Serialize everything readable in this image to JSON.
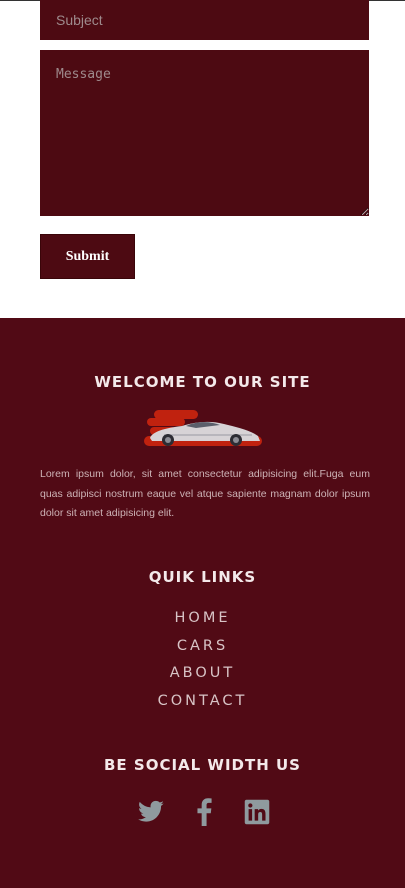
{
  "form": {
    "subject_placeholder": "Subject",
    "message_placeholder": "Message",
    "submit_label": "Submit"
  },
  "footer": {
    "welcome_title": "WELCOME TO OUR SITE",
    "about_text": "Lorem ipsum dolor, sit amet consectetur adipisicing elit.Fuga eum quas adipisci nostrum eaque vel atque sapiente magnam dolor ipsum dolor sit amet adipisicing elit.",
    "links_title": "QUIK LINKS",
    "links": [
      {
        "label": "HOME"
      },
      {
        "label": "CARS"
      },
      {
        "label": "ABOUT"
      },
      {
        "label": "CONTACT"
      }
    ],
    "social_title": "BE SOCIAL WIDTH US",
    "social": [
      {
        "icon": "twitter-icon"
      },
      {
        "icon": "facebook-icon"
      },
      {
        "icon": "linkedin-icon"
      }
    ]
  },
  "colors": {
    "footer_bg": "#510a15",
    "field_bg": "#4d0a12",
    "logo_accent": "#c0220f",
    "social_icon": "#8f9a9e"
  }
}
